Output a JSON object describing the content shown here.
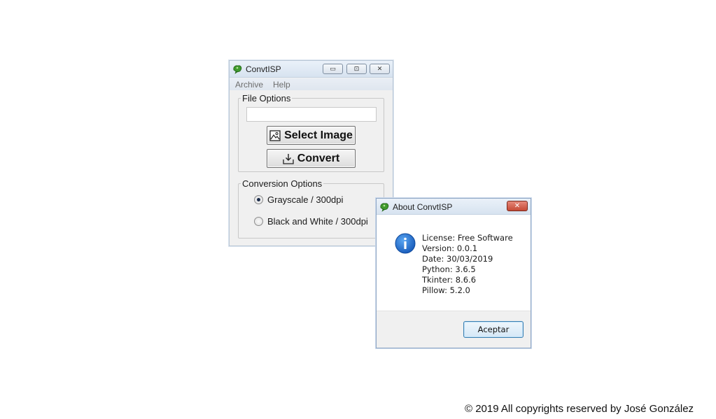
{
  "main_window": {
    "title": "ConvtISP",
    "caption_buttons": {
      "minimize": "▭",
      "maximize": "⊡",
      "close": "✕"
    },
    "menu": [
      "Archive",
      "Help"
    ],
    "file_options": {
      "legend": "File Options",
      "path_value": "",
      "select_image_label": "Select Image",
      "convert_label": "Convert"
    },
    "conversion_options": {
      "legend": "Conversion Options",
      "options": [
        {
          "label": "Grayscale / 300dpi",
          "selected": true
        },
        {
          "label": "Black and White / 300dpi",
          "selected": false
        }
      ]
    }
  },
  "about_dialog": {
    "title": "About ConvtISP",
    "close_symbol": "✕",
    "lines": [
      "License: Free Software",
      "Version: 0.0.1",
      "Date: 30/03/2019",
      "Python: 3.6.5",
      "Tkinter: 8.6.6",
      "Pillow: 5.2.0"
    ],
    "accept_label": "Aceptar",
    "icon": "info-icon",
    "icon_color": "#1e6fd0"
  },
  "footer": {
    "copyright": "© 2019 All copyrights reserved by José González"
  },
  "colors": {
    "titlebar": "#dbe6f2",
    "close_red": "#c54a36",
    "accent": "#3c7fb1"
  }
}
